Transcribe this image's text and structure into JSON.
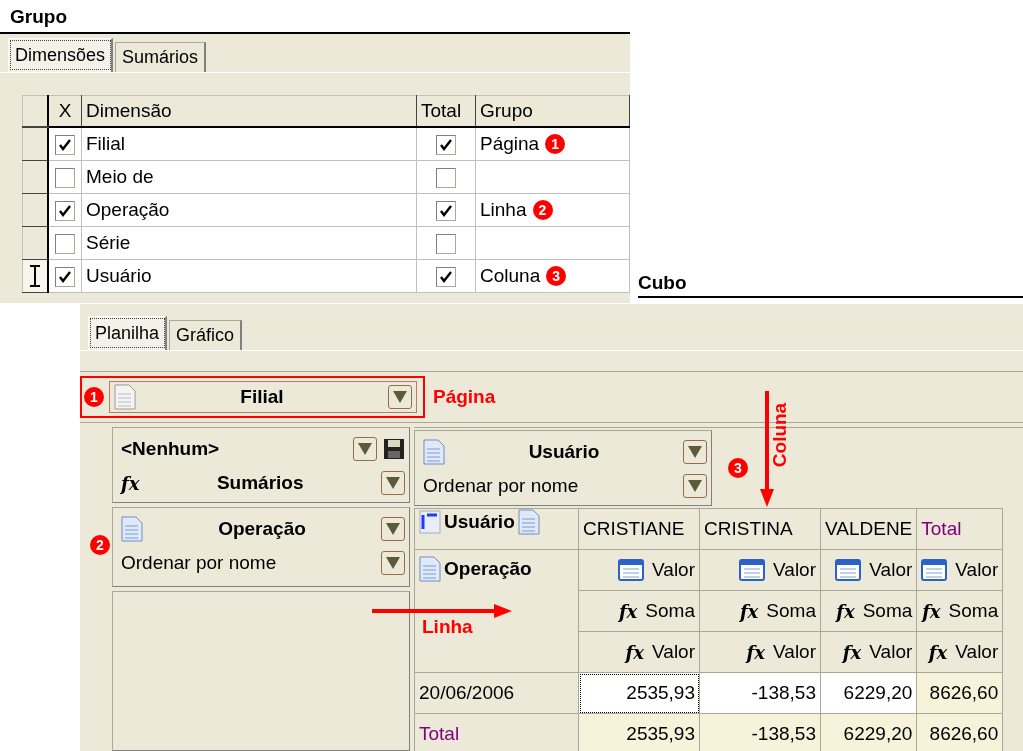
{
  "grupo": {
    "title": "Grupo",
    "tabs": [
      {
        "label": "Dimensões",
        "selected": true
      },
      {
        "label": "Sumários",
        "selected": false
      }
    ],
    "columns": [
      "X",
      "Dimensão",
      "Total",
      "Grupo"
    ],
    "rows": [
      {
        "current": false,
        "checked": true,
        "dimension": "Filial",
        "total": true,
        "group": "Página",
        "badge": "1"
      },
      {
        "current": false,
        "checked": false,
        "dimension": "Meio de",
        "total": false
      },
      {
        "current": false,
        "checked": true,
        "dimension": "Operação",
        "total": true,
        "group": "Linha",
        "badge": "2"
      },
      {
        "current": false,
        "checked": false,
        "dimension": "Série",
        "total": false
      },
      {
        "current": true,
        "checked": true,
        "dimension": "Usuário",
        "total": true,
        "group": "Coluna",
        "badge": "3"
      }
    ]
  },
  "cubo": {
    "title": "Cubo",
    "tabs": [
      {
        "label": "Planilha",
        "selected": true
      },
      {
        "label": "Gráfico",
        "selected": false
      }
    ],
    "page_field": {
      "badge": "1",
      "label": "Filial",
      "caption": "Página"
    },
    "summary_selector": {
      "value": "<Nenhum>",
      "symbol": "fx",
      "label": "Sumários"
    },
    "column_field": {
      "label": "Usuário",
      "sort": "Ordenar por nome",
      "badge": "3",
      "caption": "Coluna"
    },
    "row_field": {
      "badge": "2",
      "label": "Operação",
      "sort": "Ordenar por nome",
      "caption": "Linha"
    },
    "pivot": {
      "corner_column": "Usuário",
      "corner_row": "Operação",
      "columns": [
        {
          "label": "CRISTIANE",
          "kind": "member"
        },
        {
          "label": "CRISTINA",
          "kind": "member"
        },
        {
          "label": "VALDENE",
          "kind": "member"
        },
        {
          "label": "Total",
          "kind": "total"
        }
      ],
      "header_rows": [
        {
          "kind": "table",
          "cells": [
            {
              "label": "Valor"
            },
            {
              "label": "Valor"
            },
            {
              "label": "Valor"
            },
            {
              "label": "Valor"
            }
          ]
        },
        {
          "kind": "fx",
          "cells": [
            {
              "symbol": "fx",
              "label": "Soma"
            },
            {
              "symbol": "fx",
              "label": "Soma"
            },
            {
              "symbol": "fx",
              "label": "Soma"
            },
            {
              "symbol": "fx",
              "label": "Soma"
            }
          ]
        },
        {
          "kind": "fx",
          "cells": [
            {
              "symbol": "fx",
              "label": "Valor"
            },
            {
              "symbol": "fx",
              "label": "Valor"
            },
            {
              "symbol": "fx",
              "label": "Valor"
            },
            {
              "symbol": "fx",
              "label": "Valor"
            }
          ]
        }
      ],
      "rows": [
        {
          "kind": "data",
          "label": "20/06/2006",
          "cells": [
            {
              "value": "2535,93",
              "selected": true
            },
            {
              "value": "-138,53",
              "selected": false
            },
            {
              "value": "6229,20",
              "selected": false
            },
            {
              "value": "8626,60",
              "selected": false
            }
          ]
        },
        {
          "kind": "total",
          "label": "Total",
          "cells": [
            {
              "value": "2535,93",
              "selected": false
            },
            {
              "value": "-138,53",
              "selected": false
            },
            {
              "value": "6229,20",
              "selected": false
            },
            {
              "value": "8626,60",
              "selected": false
            }
          ]
        }
      ]
    }
  }
}
